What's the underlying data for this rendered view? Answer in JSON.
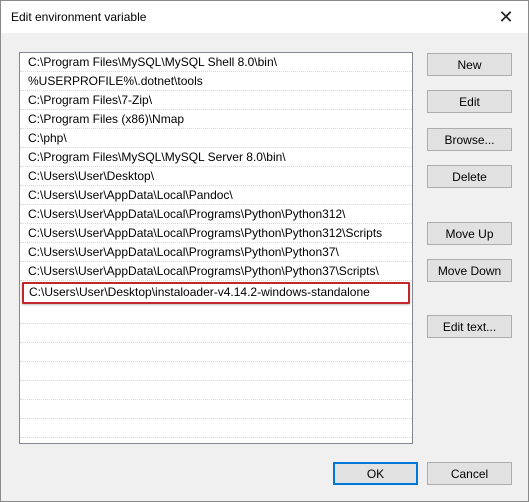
{
  "window": {
    "title": "Edit environment variable",
    "close_glyph": "✕"
  },
  "paths": [
    "C:\\Program Files\\MySQL\\MySQL Shell 8.0\\bin\\",
    "%USERPROFILE%\\.dotnet\\tools",
    "C:\\Program Files\\7-Zip\\",
    "C:\\Program Files (x86)\\Nmap",
    "C:\\php\\",
    "C:\\Program Files\\MySQL\\MySQL Server 8.0\\bin\\",
    "C:\\Users\\User\\Desktop\\",
    "C:\\Users\\User\\AppData\\Local\\Pandoc\\",
    "C:\\Users\\User\\AppData\\Local\\Programs\\Python\\Python312\\",
    "C:\\Users\\User\\AppData\\Local\\Programs\\Python\\Python312\\Scripts",
    "C:\\Users\\User\\AppData\\Local\\Programs\\Python\\Python37\\",
    "C:\\Users\\User\\AppData\\Local\\Programs\\Python\\Python37\\Scripts\\",
    "C:\\Users\\User\\Desktop\\instaloader-v4.14.2-windows-standalone"
  ],
  "buttons": {
    "new": "New",
    "edit": "Edit",
    "browse": "Browse...",
    "delete": "Delete",
    "move_up": "Move Up",
    "move_down": "Move Down",
    "edit_text": "Edit text...",
    "ok": "OK",
    "cancel": "Cancel"
  },
  "colors": {
    "highlight_border": "#c0282e",
    "ok_focus": "#0078d7"
  }
}
